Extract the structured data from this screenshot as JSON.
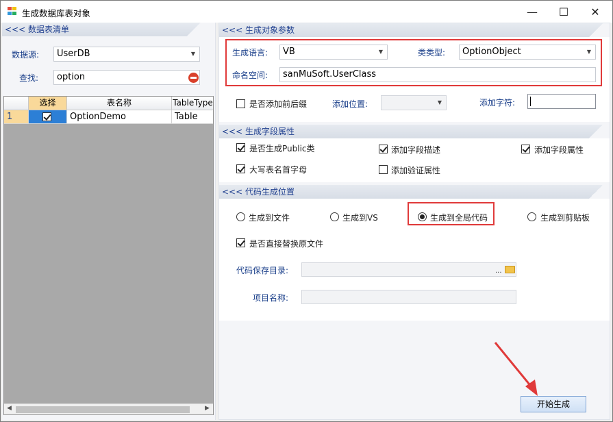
{
  "window": {
    "title": "生成数据库表对象",
    "minimize_glyph": "—",
    "maximize_glyph": "☐",
    "close_glyph": "✕"
  },
  "left_panel": {
    "band_title": "<<< 数据表清单",
    "datasource_label": "数据源:",
    "datasource_value": "UserDB",
    "search_label": "查找:",
    "search_value": "option",
    "grid": {
      "columns": [
        "选择",
        "表名称",
        "TableType"
      ],
      "rows": [
        {
          "index": "1",
          "selected": true,
          "name": "OptionDemo",
          "type": "Table"
        }
      ]
    }
  },
  "object_params": {
    "band_title": "<<< 生成对象参数",
    "language_label": "生成语言:",
    "language_value": "VB",
    "class_type_label": "类类型:",
    "class_type_value": "OptionObject",
    "namespace_label": "命名空间:",
    "namespace_value": "sanMuSoft.UserClass",
    "prefix_checkbox_label": "是否添加前后缀",
    "prefix_checked": false,
    "position_label": "添加位置:",
    "position_value": "",
    "chars_label": "添加字符:",
    "chars_value": ""
  },
  "field_props": {
    "band_title": "<<< 生成字段属性",
    "public_class_label": "是否生成Public类",
    "public_class_checked": true,
    "field_desc_label": "添加字段描述",
    "field_desc_checked": true,
    "field_attr_label": "添加字段属性",
    "field_attr_checked": true,
    "upper_first_label": "大写表名首字母",
    "upper_first_checked": true,
    "validation_label": "添加验证属性",
    "validation_checked": false
  },
  "output": {
    "band_title": "<<< 代码生成位置",
    "to_file_label": "生成到文件",
    "to_vs_label": "生成到VS",
    "to_global_label": "生成到全局代码",
    "to_clipboard_label": "生成到剪贴板",
    "selected_option": "生成到全局代码",
    "replace_label": "是否直接替换原文件",
    "replace_checked": true,
    "save_dir_label": "代码保存目录:",
    "save_dir_value": "",
    "browse_glyph": "...",
    "project_label": "项目名称:",
    "project_value": ""
  },
  "start_button_label": "开始生成",
  "colors": {
    "band_text": "#1f3f8f",
    "highlight": "#e03a3a",
    "grid_header_selected": "#f9d99a",
    "row_selected": "#2c7fd6"
  }
}
